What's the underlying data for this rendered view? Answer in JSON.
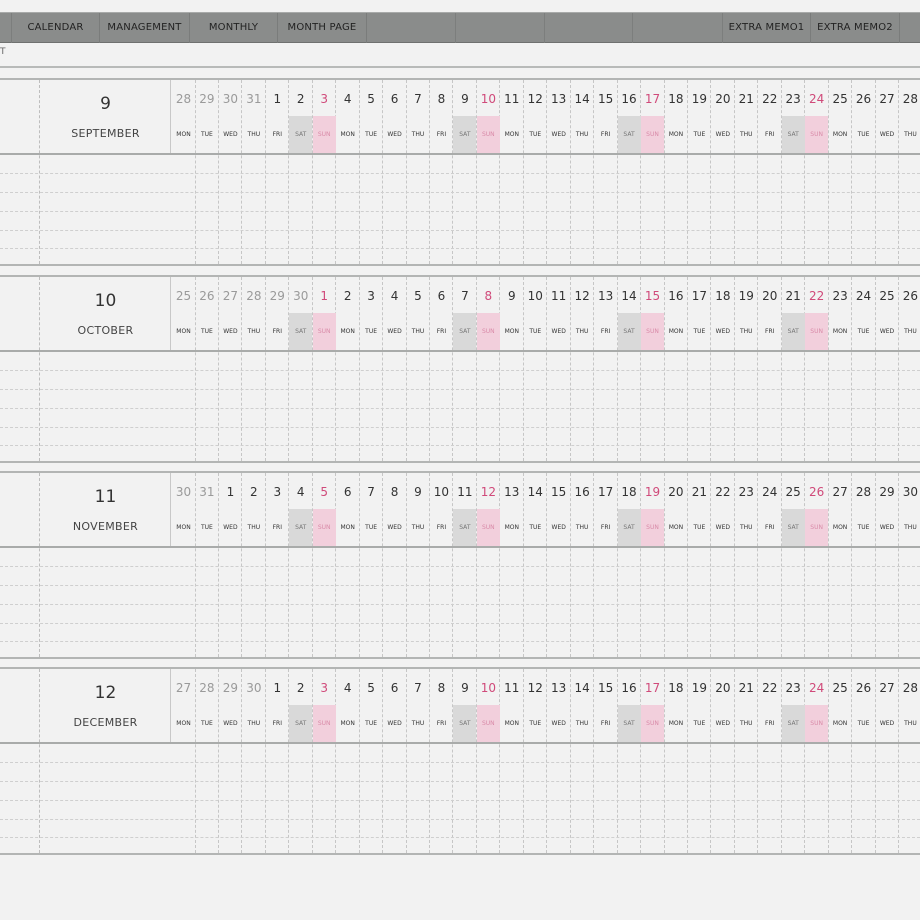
{
  "nav": {
    "tabs": [
      {
        "label": "",
        "w": 12
      },
      {
        "label": "CALENDAR",
        "w": 88
      },
      {
        "label": "MANAGEMENT",
        "w": 90
      },
      {
        "label": "MONTHLY",
        "w": 88
      },
      {
        "label": "MONTH PAGE",
        "w": 89
      },
      {
        "label": "",
        "w": 89
      },
      {
        "label": "",
        "w": 89
      },
      {
        "label": "",
        "w": 88
      },
      {
        "label": "",
        "w": 90
      },
      {
        "label": "EXTRA MEMO1",
        "w": 88
      },
      {
        "label": "EXTRA MEMO2",
        "w": 89
      },
      {
        "label": "",
        "w": 40
      }
    ]
  },
  "sub_mark": "T",
  "weekdays": [
    "MON",
    "TUE",
    "WED",
    "THU",
    "FRI",
    "SAT",
    "SUN"
  ],
  "months": [
    {
      "number": "9",
      "name": "SEPTEMBER",
      "days": [
        "28",
        "29",
        "30",
        "31",
        "1",
        "2",
        "3",
        "4",
        "5",
        "6",
        "7",
        "8",
        "9",
        "10",
        "11",
        "12",
        "13",
        "14",
        "15",
        "16",
        "17",
        "18",
        "19",
        "20",
        "21",
        "22",
        "23",
        "24",
        "25",
        "26",
        "27",
        "28"
      ],
      "out_prefix": 4
    },
    {
      "number": "10",
      "name": "OCTOBER",
      "days": [
        "25",
        "26",
        "27",
        "28",
        "29",
        "30",
        "1",
        "2",
        "3",
        "4",
        "5",
        "6",
        "7",
        "8",
        "9",
        "10",
        "11",
        "12",
        "13",
        "14",
        "15",
        "16",
        "17",
        "18",
        "19",
        "20",
        "21",
        "22",
        "23",
        "24",
        "25",
        "26"
      ],
      "out_prefix": 6
    },
    {
      "number": "11",
      "name": "NOVEMBER",
      "days": [
        "30",
        "31",
        "1",
        "2",
        "3",
        "4",
        "5",
        "6",
        "7",
        "8",
        "9",
        "10",
        "11",
        "12",
        "13",
        "14",
        "15",
        "16",
        "17",
        "18",
        "19",
        "20",
        "21",
        "22",
        "23",
        "24",
        "25",
        "26",
        "27",
        "28",
        "29",
        "30"
      ],
      "out_prefix": 2
    },
    {
      "number": "12",
      "name": "DECEMBER",
      "days": [
        "27",
        "28",
        "29",
        "30",
        "1",
        "2",
        "3",
        "4",
        "5",
        "6",
        "7",
        "8",
        "9",
        "10",
        "11",
        "12",
        "13",
        "14",
        "15",
        "16",
        "17",
        "18",
        "19",
        "20",
        "21",
        "22",
        "23",
        "24",
        "25",
        "26",
        "27",
        "28"
      ],
      "out_prefix": 4
    }
  ],
  "colors": {
    "sunday": "#d04a7a",
    "saturday_bg": "#d9d9d9",
    "sunday_bg": "#f2cfdc",
    "nav_bg": "#8a8c8b"
  }
}
